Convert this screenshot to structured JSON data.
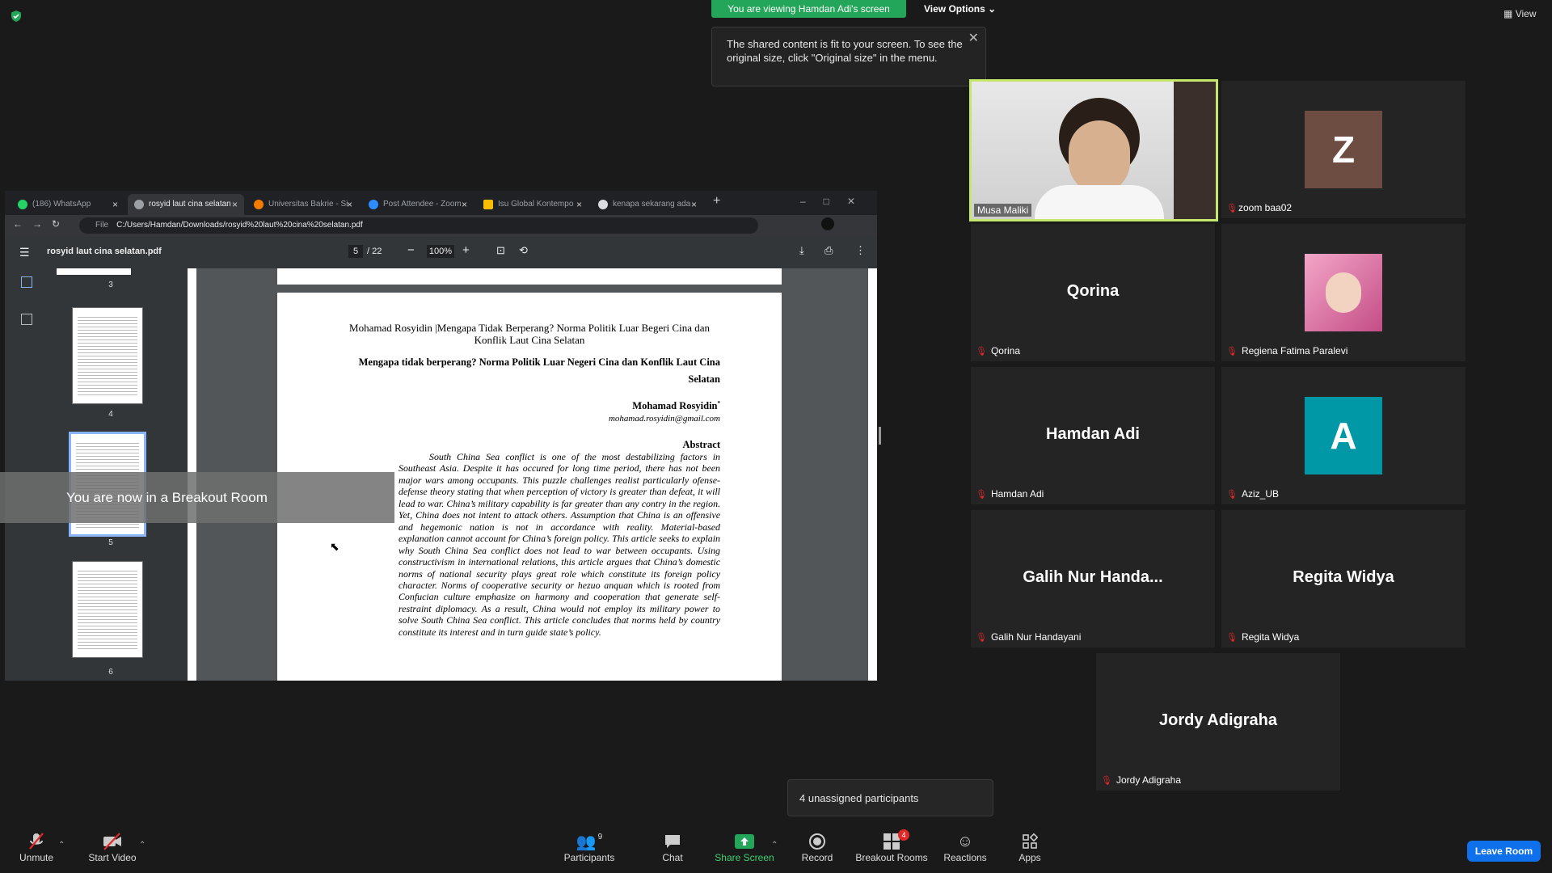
{
  "top": {
    "viewing_label": "You are viewing Hamdan Adi's screen",
    "view_options_label": "View Options",
    "fit_tip": "The shared content is fit to your screen. To see the original size, click \"Original size\" in the menu.",
    "view_label": "View"
  },
  "browser": {
    "tabs": [
      {
        "label": "(186) WhatsApp",
        "color": "#25d366"
      },
      {
        "label": "rosyid laut cina selatan",
        "color": "#9aa0a6"
      },
      {
        "label": "Universitas Bakrie - Si",
        "color": "#f57c00"
      },
      {
        "label": "Post Attendee - Zoom",
        "color": "#2d8cff"
      },
      {
        "label": "Isu Global Kontempo",
        "color": "#fbbc04"
      },
      {
        "label": "kenapa sekarang ada",
        "color": "#dadce0"
      }
    ],
    "address_prefix": "File",
    "address": "C:/Users/Hamdan/Downloads/rosyid%20laut%20cina%20selatan.pdf"
  },
  "pdf": {
    "filename": "rosyid laut cina selatan.pdf",
    "page_current": "5",
    "page_total": "/ 22",
    "zoom": "100%",
    "thumbs": [
      "3",
      "4",
      "5",
      "6"
    ],
    "header": "Mohamad Rosyidin |Mengapa Tidak Berperang? Norma Politik Luar Begeri Cina dan Konflik Laut Cina Selatan",
    "title": "Mengapa tidak berperang? Norma Politik Luar Negeri Cina dan Konflik Laut Cina Selatan",
    "author": "Mohamad Rosyidin",
    "author_mark": "*",
    "email": "mohamad.rosyidin@gmail.com",
    "abstract_heading": "Abstract",
    "abstract_text": "South China Sea conflict is one of the most destabilizing factors in Southeast Asia. Despite it has occured for long time period, there has not been major wars among occupants. This puzzle challenges realist particularly ofense-defense theory stating that when perception of victory is greater than defeat, it will lead to war. China’s military capability is far greater than any contry in the region. Yet, China does not intent to attack others. Assumption that China is an offensive and hegemonic nation is not in accordance with reality. Material-based explanation cannot account for China’s foreign policy. This article seeks to explain why South China Sea conflict does not lead to war between occupants. Using constructivism in international relations, this article argues that China’s domestic norms of national security plays great role which constitute its foreign policy character. Norms of cooperative security or hezuo anquan which is rooted from Confucian culture emphasize on harmony and cooperation that generate self-restraint diplomacy. As a result, China would not employ its military power to solve South China Sea conflict. This article concludes that norms held by country constitute its interest and in turn guide state’s policy."
  },
  "breakout_toast": "You are now in a Breakout Room",
  "participants": [
    {
      "display": "",
      "name": "Musa Maliki",
      "type": "video"
    },
    {
      "display": "Z",
      "name": "zoom baa02",
      "type": "letter",
      "bg": "#6d4c41"
    },
    {
      "display": "Qorina",
      "name": "Qorina",
      "type": "text"
    },
    {
      "display": "",
      "name": "Regiena Fatima Paralevi",
      "type": "photo"
    },
    {
      "display": "Hamdan Adi",
      "name": "Hamdan Adi",
      "type": "text"
    },
    {
      "display": "A",
      "name": "Aziz_UB",
      "type": "letter",
      "bg": "#0097a7"
    },
    {
      "display": "Galih Nur Handa...",
      "name": "Galih Nur Handayani",
      "type": "text"
    },
    {
      "display": "Regita Widya",
      "name": "Regita Widya",
      "type": "text"
    },
    {
      "display": "Jordy Adigraha",
      "name": "Jordy Adigraha",
      "type": "text"
    }
  ],
  "unassigned": "4 unassigned participants",
  "toolbar": {
    "unmute": "Unmute",
    "start_video": "Start Video",
    "participants": "Participants",
    "participants_count": "9",
    "chat": "Chat",
    "share_screen": "Share Screen",
    "record": "Record",
    "breakout_rooms": "Breakout Rooms",
    "breakout_badge": "4",
    "reactions": "Reactions",
    "apps": "Apps",
    "leave_room": "Leave Room"
  },
  "colors": {
    "accent": "#0e71eb",
    "share_green": "#23a55a",
    "speaker_border": "#c5e86c"
  }
}
